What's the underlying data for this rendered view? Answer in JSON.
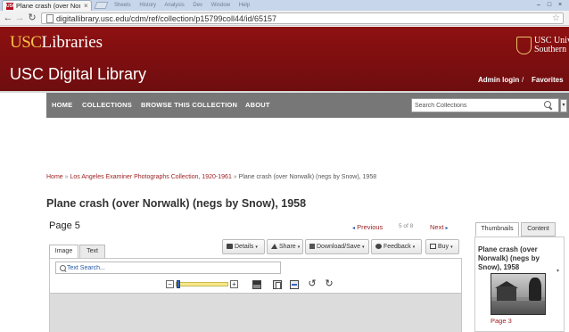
{
  "browser": {
    "tab_title": "Plane crash (over Norwalk",
    "tab_favicon": "USC",
    "tab_close": "×",
    "menu_items": [
      "Sheets",
      "History",
      "Analysis",
      "Dev",
      "Window",
      "Help"
    ],
    "window_controls": [
      "–",
      "□",
      "×"
    ],
    "url": "digitallibrary.usc.edu/cdm/ref/collection/p15799coll44/id/65157",
    "back_icon": "back-arrow-icon",
    "forward_icon": "forward-arrow-icon",
    "reload_icon": "reload-icon",
    "star_icon": "☆"
  },
  "header": {
    "logo_usc": "USC",
    "logo_libraries": "Libraries",
    "site_title": "USC Digital Library",
    "university_line1": "USC Univ",
    "university_line2": "Southern",
    "admin_login": "Admin login",
    "separator": "/",
    "favorites": "Favorites",
    "brand_color": "#7a0e10",
    "logo_accent": "#f6c347"
  },
  "nav": {
    "items": [
      "HOME",
      "COLLECTIONS",
      "BROWSE THIS COLLECTION",
      "ABOUT"
    ],
    "search_placeholder": "Search Collections",
    "search_dropdown": "▾"
  },
  "breadcrumb": {
    "home": "Home",
    "sep": "»",
    "collection": "Los Angeles Examiner Photographs Collection, 1920-1961",
    "sep2": "»",
    "current": "Plane crash (over Norwalk) (negs by Snow), 1958"
  },
  "item": {
    "title": "Plane crash (over Norwalk) (negs by Snow), 1958",
    "page_label": "Page 5",
    "previous": "Previous",
    "page_count": "5 of 8",
    "next": "Next",
    "prev_arrow": "◂",
    "next_arrow": "▸"
  },
  "viewer_tabs": [
    "Image",
    "Text"
  ],
  "toolbar": {
    "details": "Details",
    "share": "Share",
    "download": "Download/Save",
    "feedback": "Feedback",
    "buy": "Buy",
    "caret": "▾"
  },
  "viewer": {
    "text_search_placeholder": "Text Search...",
    "zoom_minus": "−",
    "zoom_plus": "+",
    "zoom_level_fraction": 0.05,
    "rotate_left": "↺",
    "rotate_right": "↻"
  },
  "sidebar": {
    "tabs": [
      "Thumbnails",
      "Content"
    ],
    "thumb_title": "Plane crash (over Norwalk) (negs by Snow), 1958",
    "thumb_label": "Page 3",
    "scroll_arrow": "▾"
  }
}
